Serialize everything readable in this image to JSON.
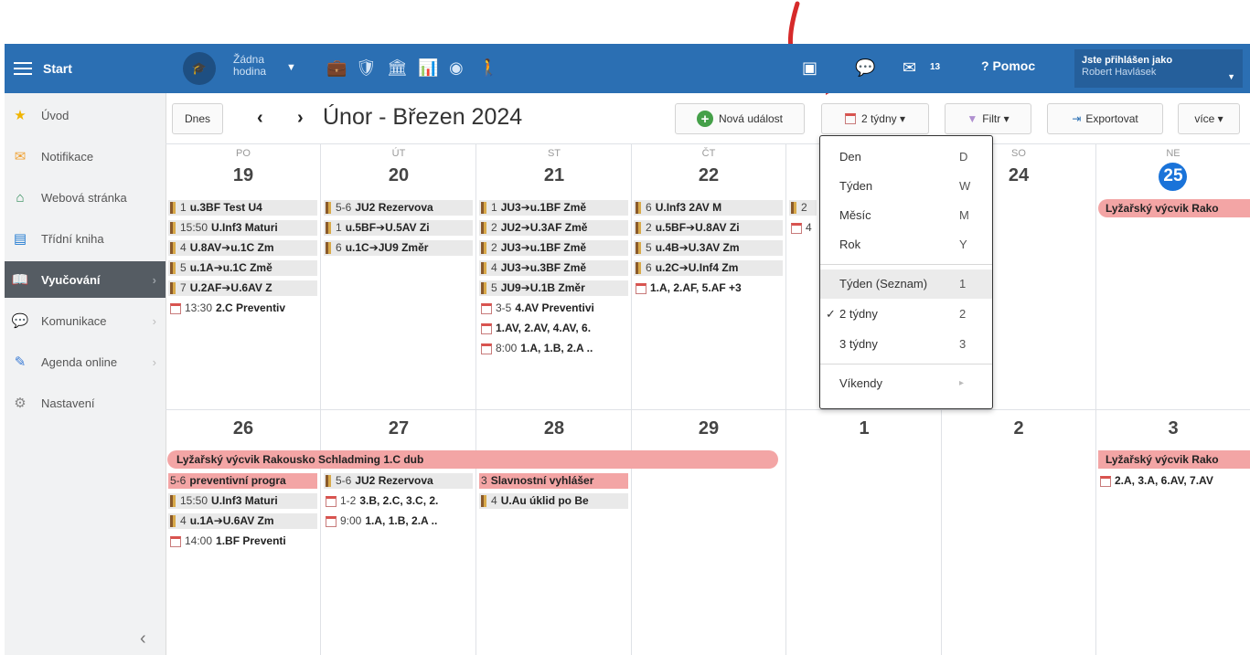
{
  "topbar": {
    "start_label": "Start",
    "hodina_label": "Žádna hodina",
    "notif_count": "13",
    "help_label": "Pomoc",
    "user_caption": "Jste přihlášen jako",
    "user_name": "Robert Havlásek"
  },
  "sidebar": {
    "items": [
      {
        "label": "Úvod",
        "icon": "star-icon"
      },
      {
        "label": "Notifikace",
        "icon": "envelope-icon"
      },
      {
        "label": "Webová stránka",
        "icon": "home-icon"
      },
      {
        "label": "Třídní kniha",
        "icon": "book-icon"
      },
      {
        "label": "Vyučování",
        "icon": "open-book-icon"
      },
      {
        "label": "Komunikace",
        "icon": "chat-icon"
      },
      {
        "label": "Agenda online",
        "icon": "pencil-icon"
      },
      {
        "label": "Nastavení",
        "icon": "gear-icon"
      }
    ]
  },
  "toolbar": {
    "today": "Dnes",
    "title": "Únor - Březen 2024",
    "new_event": "Nová událost",
    "view": "2 týdny ▾",
    "filter": "Filtr ▾",
    "export": "Exportovat",
    "more": "více ▾"
  },
  "calendar": {
    "day_names": [
      "PO",
      "ÚT",
      "ST",
      "ČT",
      "",
      "SO",
      "NE"
    ],
    "week1_days": [
      "19",
      "20",
      "21",
      "22",
      "",
      "24",
      "25"
    ],
    "week2_days": [
      "26",
      "27",
      "28",
      "29",
      "1",
      "2",
      "3"
    ],
    "events": {
      "mon1": [
        {
          "type": "tag",
          "time": "1",
          "text": "u.3BF Test U4"
        },
        {
          "type": "tag",
          "time": "15:50",
          "text": "U.Inf3 Maturi"
        },
        {
          "type": "tag",
          "time": "4",
          "text": "U.8AV➔u.1C Zm"
        },
        {
          "type": "tag",
          "time": "5",
          "text": "u.1A➔u.1C Změ"
        },
        {
          "type": "tag",
          "time": "7",
          "text": "U.2AF➔U.6AV Z"
        },
        {
          "type": "page",
          "time": "13:30",
          "text": "2.C Preventiv"
        }
      ],
      "tue1": [
        {
          "type": "tag",
          "time": "5-6",
          "text": "JU2 Rezervova"
        },
        {
          "type": "tag",
          "time": "1",
          "text": "u.5BF➔U.5AV Zi"
        },
        {
          "type": "tag",
          "time": "6",
          "text": "u.1C➔JU9 Změr"
        }
      ],
      "wed1": [
        {
          "type": "tag",
          "time": "1",
          "text": "JU3➔u.1BF Změ"
        },
        {
          "type": "tag",
          "time": "2",
          "text": "JU2➔U.3AF Změ"
        },
        {
          "type": "tag",
          "time": "2",
          "text": "JU3➔u.1BF Změ"
        },
        {
          "type": "tag",
          "time": "4",
          "text": "JU3➔u.3BF Změ"
        },
        {
          "type": "tag",
          "time": "5",
          "text": "JU9➔U.1B Změr"
        },
        {
          "type": "page",
          "time": "3-5",
          "text": "4.AV Preventivi"
        },
        {
          "type": "page",
          "time": "",
          "text": "1.AV, 2.AV, 4.AV, 6."
        },
        {
          "type": "page",
          "time": "8:00",
          "text": "1.A, 1.B, 2.A .."
        }
      ],
      "thu1": [
        {
          "type": "tag",
          "time": "6",
          "text": "U.Inf3 2AV M"
        },
        {
          "type": "tag",
          "time": "2",
          "text": "u.5BF➔U.8AV Zi"
        },
        {
          "type": "tag",
          "time": "5",
          "text": "u.4B➔U.3AV Zm"
        },
        {
          "type": "tag",
          "time": "6",
          "text": "u.2C➔U.Inf4 Zm"
        },
        {
          "type": "page",
          "time": "",
          "text": "1.A, 2.AF, 5.AF +3"
        }
      ],
      "fri1": [
        {
          "type": "tag",
          "time": "2",
          "text": ""
        },
        {
          "type": "page",
          "time": "4",
          "text": ""
        }
      ],
      "sun1_bar": "Lyžařský výcvik Rako",
      "week2_bar": "Lyžařský výcvik Rakousko Schladming 1.C dub",
      "mon2": [
        {
          "type": "pink",
          "time": "5-6",
          "text": "preventivní progra"
        },
        {
          "type": "tag",
          "time": "15:50",
          "text": "U.Inf3 Maturi"
        },
        {
          "type": "tag",
          "time": "4",
          "text": "u.1A➔U.6AV Zm"
        },
        {
          "type": "page",
          "time": "14:00",
          "text": "1.BF Preventi"
        }
      ],
      "tue2": [
        {
          "type": "tag",
          "time": "5-6",
          "text": "JU2 Rezervova"
        },
        {
          "type": "page",
          "time": "1-2",
          "text": "3.B, 2.C, 3.C, 2."
        },
        {
          "type": "page",
          "time": "9:00",
          "text": "1.A, 1.B, 2.A .."
        }
      ],
      "wed2": [
        {
          "type": "pink",
          "time": "3",
          "text": "Slavnostní vyhlášer"
        },
        {
          "type": "tag",
          "time": "4",
          "text": "U.Au úklid po Be"
        }
      ],
      "sun2_bar": "Lyžařský výcvik Rako",
      "sun2": [
        {
          "type": "page",
          "time": "",
          "text": "2.A, 3.A, 6.AV, 7.AV"
        }
      ]
    }
  },
  "dropdown": {
    "items": [
      {
        "label": "Den",
        "key": "D"
      },
      {
        "label": "Týden",
        "key": "W"
      },
      {
        "label": "Měsíc",
        "key": "M"
      },
      {
        "label": "Rok",
        "key": "Y"
      },
      {
        "label": "Týden (Seznam)",
        "key": "1"
      },
      {
        "label": "2 týdny",
        "key": "2",
        "checked": true
      },
      {
        "label": "3 týdny",
        "key": "3"
      },
      {
        "label": "Víkendy",
        "key": "▸"
      }
    ]
  },
  "colors": {
    "topbar": "#2b6fb3",
    "sidebar_active": "#555c63",
    "today": "#1a73d9",
    "pink_event": "#f3a5a5",
    "arrow": "#d62a2a"
  }
}
